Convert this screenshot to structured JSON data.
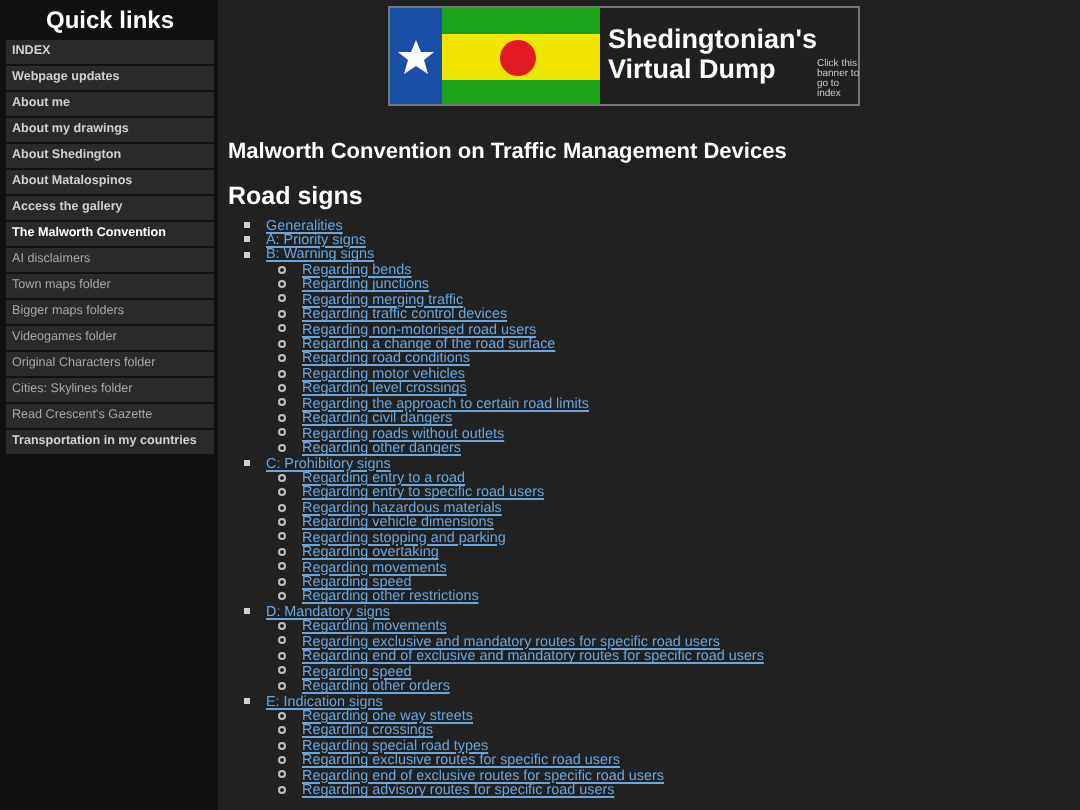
{
  "sidebar": {
    "title": "Quick links",
    "items": [
      {
        "label": "INDEX",
        "bold": true,
        "selected": false
      },
      {
        "label": "Webpage updates",
        "bold": true,
        "selected": false
      },
      {
        "label": "About me",
        "bold": true,
        "selected": false
      },
      {
        "label": "About my drawings",
        "bold": true,
        "selected": false
      },
      {
        "label": "About Shedington",
        "bold": true,
        "selected": false
      },
      {
        "label": "About Matalospinos",
        "bold": true,
        "selected": false
      },
      {
        "label": "Access the gallery",
        "bold": true,
        "selected": false
      },
      {
        "label": "The Malworth Convention",
        "bold": true,
        "selected": true
      },
      {
        "label": "AI disclaimers",
        "bold": false,
        "selected": false
      },
      {
        "label": "Town maps folder",
        "bold": false,
        "selected": false
      },
      {
        "label": "Bigger maps folders",
        "bold": false,
        "selected": false
      },
      {
        "label": "Videogames folder",
        "bold": false,
        "selected": false
      },
      {
        "label": "Original Characters folder",
        "bold": false,
        "selected": false
      },
      {
        "label": "Cities: Skylines folder",
        "bold": false,
        "selected": false
      },
      {
        "label": "Read Crescent's Gazette",
        "bold": false,
        "selected": false
      },
      {
        "label": "Transportation in my countries",
        "bold": true,
        "selected": false
      }
    ]
  },
  "banner": {
    "title_line_1": "Shedingtonian's",
    "title_line_2": "Virtual Dump",
    "note": "Click this banner to go to index"
  },
  "heading": "Malworth Convention on Traffic Management Devices",
  "subheading": "Road signs",
  "contents": [
    {
      "label": "Generalities"
    },
    {
      "label": "A: Priority signs"
    },
    {
      "label": "B: Warning signs",
      "children": [
        {
          "label": "Regarding bends"
        },
        {
          "label": "Regarding junctions"
        },
        {
          "label": "Regarding merging traffic"
        },
        {
          "label": "Regarding traffic control devices"
        },
        {
          "label": "Regarding non-motorised road users"
        },
        {
          "label": "Regarding a change of the road surface"
        },
        {
          "label": "Regarding road conditions"
        },
        {
          "label": "Regarding motor vehicles"
        },
        {
          "label": "Regarding level crossings"
        },
        {
          "label": "Regarding the approach to certain road limits"
        },
        {
          "label": "Regarding civil dangers"
        },
        {
          "label": "Regarding roads without outlets"
        },
        {
          "label": "Regarding other dangers"
        }
      ]
    },
    {
      "label": "C: Prohibitory signs",
      "children": [
        {
          "label": "Regarding entry to a road"
        },
        {
          "label": "Regarding entry to specific road users"
        },
        {
          "label": "Regarding hazardous materials"
        },
        {
          "label": "Regarding vehicle dimensions"
        },
        {
          "label": "Regarding stopping and parking"
        },
        {
          "label": "Regarding overtaking"
        },
        {
          "label": "Regarding movements"
        },
        {
          "label": "Regarding speed"
        },
        {
          "label": "Regarding other restrictions"
        }
      ]
    },
    {
      "label": "D: Mandatory signs",
      "children": [
        {
          "label": "Regarding movements"
        },
        {
          "label": "Regarding exclusive and mandatory routes for specific road users"
        },
        {
          "label": "Regarding end of exclusive and mandatory routes for specific road users"
        },
        {
          "label": "Regarding speed"
        },
        {
          "label": "Regarding other orders"
        }
      ]
    },
    {
      "label": "E: Indication signs",
      "children": [
        {
          "label": "Regarding one way streets"
        },
        {
          "label": "Regarding crossings"
        },
        {
          "label": "Regarding special road types"
        },
        {
          "label": "Regarding exclusive routes for specific road users"
        },
        {
          "label": "Regarding end of exclusive routes for specific road users"
        },
        {
          "label": "Regarding advisory routes for specific road users"
        }
      ]
    }
  ]
}
